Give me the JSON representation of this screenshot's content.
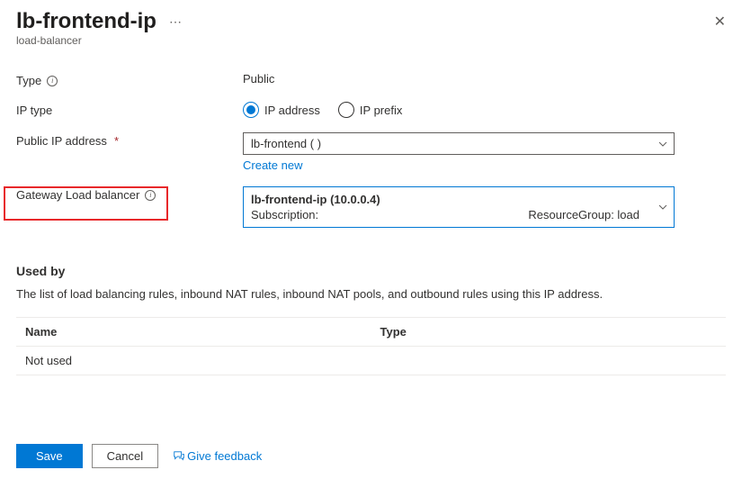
{
  "header": {
    "title": "lb-frontend-ip",
    "subtitle": "load-balancer"
  },
  "form": {
    "type_label": "Type",
    "type_value": "Public",
    "iptype_label": "IP type",
    "iptype_options": {
      "address": "IP address",
      "prefix": "IP prefix"
    },
    "pubip_label": "Public IP address",
    "pubip_value": "lb-frontend (                             )",
    "create_new": "Create new",
    "gwlb_label": "Gateway Load balancer",
    "gwlb_title": "lb-frontend-ip (10.0.0.4)",
    "gwlb_sub_left": "Subscription:",
    "gwlb_sub_right": "ResourceGroup: load"
  },
  "usedby": {
    "heading": "Used by",
    "desc": "The list of load balancing rules, inbound NAT rules, inbound NAT pools, and outbound rules using this IP address.",
    "col_name": "Name",
    "col_type": "Type",
    "empty": "Not used"
  },
  "footer": {
    "save": "Save",
    "cancel": "Cancel",
    "feedback": "Give feedback"
  }
}
